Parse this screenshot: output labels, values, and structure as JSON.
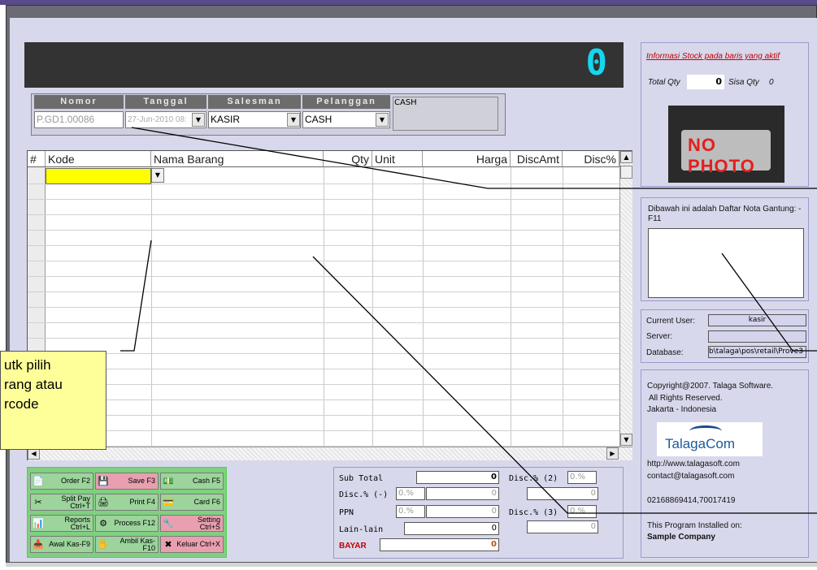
{
  "display": {
    "value": "0"
  },
  "header": {
    "labels": {
      "nomor": "Nomor",
      "tanggal": "Tanggal",
      "salesman": "Salesman",
      "pelanggan": "Pelanggan"
    },
    "nomor_value": "P.GD1.00086",
    "tanggal_value": "27-Jun-2010 08:",
    "salesman_value": "KASIR",
    "pelanggan_value": "CASH",
    "customer_info": "CASH"
  },
  "grid": {
    "columns": [
      "#",
      "Kode",
      "Nama Barang",
      "Qty",
      "Unit",
      "Harga",
      "DiscAmt",
      "Disc%"
    ]
  },
  "buttons": [
    {
      "icon": "📄",
      "label": "Order F2"
    },
    {
      "icon": "💾",
      "label": "Save F3"
    },
    {
      "icon": "💵",
      "label": "Cash F5"
    },
    {
      "icon": "✂",
      "label": "Split Pay Ctrl+T"
    },
    {
      "icon": "🖨",
      "label": "Print F4"
    },
    {
      "icon": "💳",
      "label": "Card F6"
    },
    {
      "icon": "📊",
      "label": "Reports Ctrl+L"
    },
    {
      "icon": "⚙",
      "label": "Process F12"
    },
    {
      "icon": "🔧",
      "label": "Setting Ctrl+S"
    },
    {
      "icon": "📥",
      "label": "Awal Kas-F9"
    },
    {
      "icon": "✋",
      "label": "Ambil Kas-F10"
    },
    {
      "icon": "✖",
      "label": "Keluar Ctrl+X"
    }
  ],
  "totals": {
    "sub_total_label": "Sub Total",
    "sub_total": "0",
    "disc_minus_label": "Disc.% (-)",
    "disc_minus_pct": "0.%",
    "disc_minus_amt": "0",
    "ppn_label": "PPN",
    "ppn_pct": "0.%",
    "ppn_amt": "0",
    "lain_label": "Lain-lain",
    "lain_amt": "0",
    "bayar_label": "BAYAR",
    "bayar_amt": "0",
    "disc2_label": "Disc.% (2)",
    "disc2_pct": "0.%",
    "disc2_amt": "0",
    "disc3_label": "Disc.% (3)",
    "disc3_pct": "0.%",
    "disc3_amt": "0"
  },
  "side": {
    "stock_info_link": "Informasi Stock pada baris yang aktif",
    "total_qty_label": "Total Qty",
    "total_qty": "0",
    "sisa_qty_label": "Sisa Qty",
    "sisa_qty": "0",
    "no_photo": "NO PHOTO",
    "nota_gantung_text": "Dibawah ini adalah Daftar Nota Gantung: - F11",
    "current_user_label": "Current User:",
    "current_user": "kasir",
    "server_label": "Server:",
    "server": "",
    "database_label": "Database:",
    "database": "b\\talaga\\pos\\retail\\Prove3",
    "copyright": "Copyright@2007. Talaga Software.",
    "rights": "All Rights Reserved.",
    "location": "Jakarta - Indonesia",
    "logo": "TalagaCom",
    "website": "http://www.talagasoft.com",
    "contact": "contact@talagasoft.com",
    "phone": "02168869414,70017419",
    "installed_label": "This Program Installed on:",
    "installed_on": "Sample Company"
  },
  "callout": {
    "line1": "utk pilih",
    "line2": "rang atau",
    "line3": "rcode"
  }
}
